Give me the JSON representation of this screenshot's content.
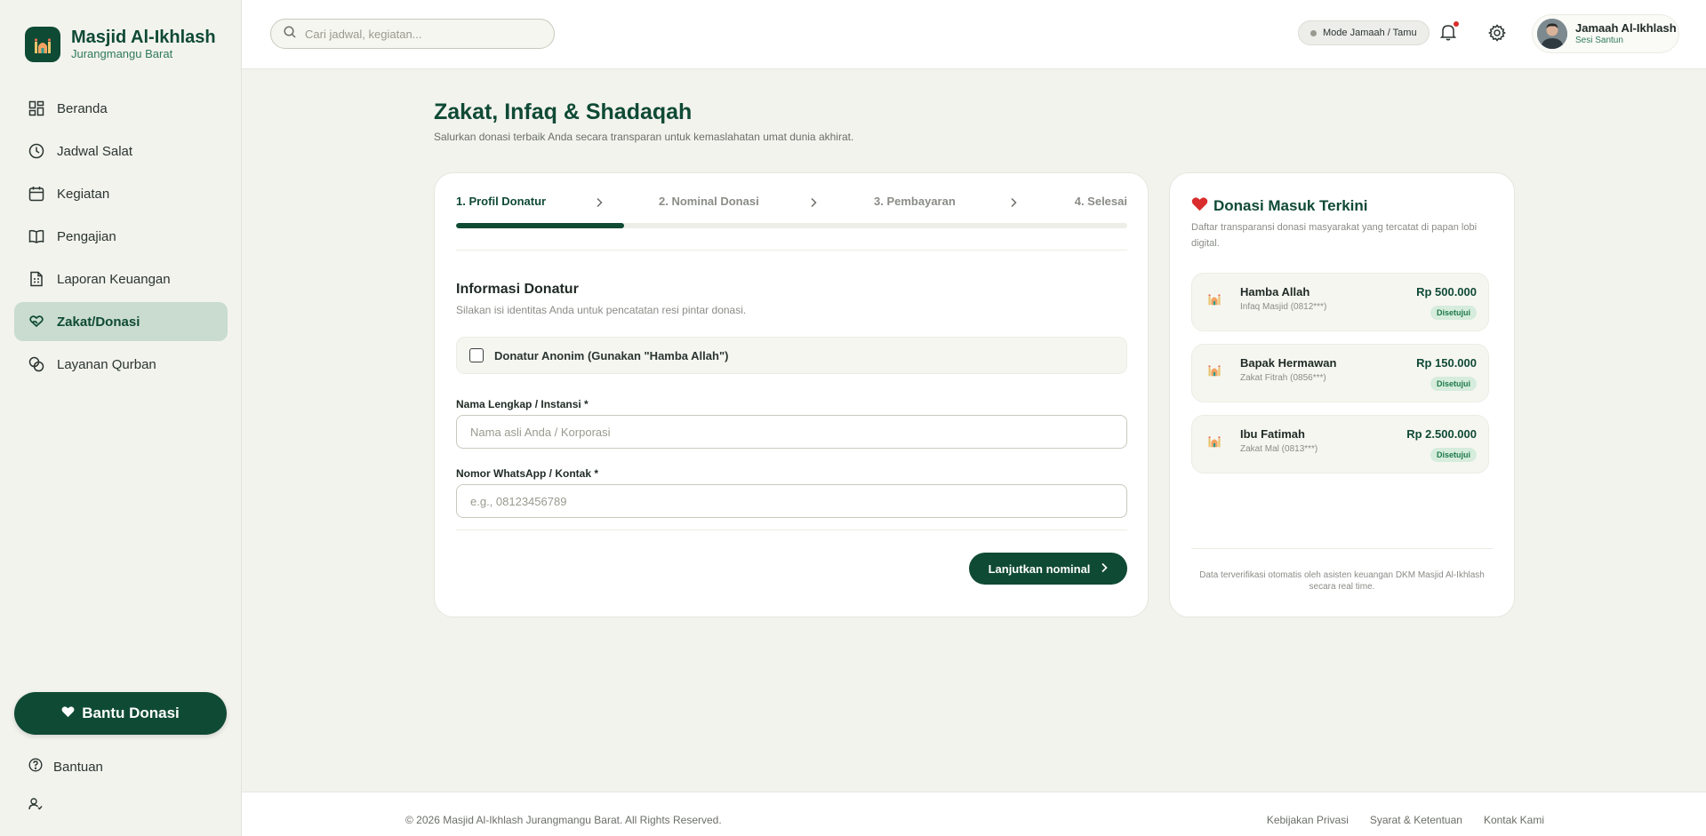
{
  "brand": {
    "name": "Masjid Al-Ikhlash",
    "subtitle": "Jurangmangu Barat",
    "logo_icon": "mosque-icon"
  },
  "sidebar": {
    "items": [
      {
        "label": "Beranda",
        "icon": "dashboard-icon",
        "active": false
      },
      {
        "label": "Jadwal Salat",
        "icon": "clock-icon",
        "active": false
      },
      {
        "label": "Kegiatan",
        "icon": "calendar-icon",
        "active": false
      },
      {
        "label": "Pengajian",
        "icon": "book-icon",
        "active": false
      },
      {
        "label": "Laporan Keuangan",
        "icon": "report-icon",
        "active": false
      },
      {
        "label": "Zakat/Donasi",
        "icon": "hand-heart-icon",
        "active": true
      },
      {
        "label": "Layanan Qurban",
        "icon": "coins-icon",
        "active": false
      }
    ],
    "donate_button": "Bantu Donasi",
    "help_label": "Bantuan"
  },
  "header": {
    "search_placeholder": "Cari jadwal, kegiatan...",
    "mode_label": "Mode Jamaah / Tamu",
    "user_name": "Jamaah Al-Ikhlash",
    "user_role": "Sesi Santun"
  },
  "page": {
    "title": "Zakat, Infaq & Shadaqah",
    "subtitle": "Salurkan donasi terbaik Anda secara transparan untuk kemaslahatan umat dunia akhirat."
  },
  "wizard": {
    "steps": [
      "1. Profil Donatur",
      "2. Nominal Donasi",
      "3. Pembayaran",
      "4. Selesai"
    ],
    "current_step": 1,
    "progress": 0.25,
    "section_title": "Informasi Donatur",
    "section_subtitle": "Silakan isi identitas Anda untuk pencatatan resi pintar donasi.",
    "anon_label": "Donatur Anonim (Gunakan \"Hamba Allah\")",
    "name_label": "Nama Lengkap / Instansi *",
    "name_placeholder": "Nama asli Anda / Korporasi",
    "phone_label": "Nomor WhatsApp / Kontak *",
    "phone_placeholder": "e.g., 08123456789",
    "next_button": "Lanjutkan nominal"
  },
  "recent": {
    "title": "Donasi Masuk Terkini",
    "subtitle": "Daftar transparansi donasi masyarakat yang tercatat di papan lobi digital.",
    "items": [
      {
        "name": "Hamba Allah",
        "meta": "Infaq Masjid (0812***)",
        "amount": "Rp 500.000",
        "status": "Disetujui"
      },
      {
        "name": "Bapak Hermawan",
        "meta": "Zakat Fitrah (0856***)",
        "amount": "Rp 150.000",
        "status": "Disetujui"
      },
      {
        "name": "Ibu Fatimah",
        "meta": "Zakat Mal (0813***)",
        "amount": "Rp 2.500.000",
        "status": "Disetujui"
      }
    ],
    "footnote": "Data terverifikasi otomatis oleh asisten keuangan DKM Masjid Al-Ikhlash secara real time."
  },
  "footer": {
    "copyright": "© 2026 Masjid Al-Ikhlash Jurangmangu Barat. All Rights Reserved.",
    "links": [
      "Kebijakan Privasi",
      "Syarat & Ketentuan",
      "Kontak Kami"
    ]
  },
  "colors": {
    "primary": "#0f4a35",
    "active_nav_bg": "#c9dccf",
    "badge_bg": "#d6ecdc",
    "heart": "#d92d2d"
  }
}
